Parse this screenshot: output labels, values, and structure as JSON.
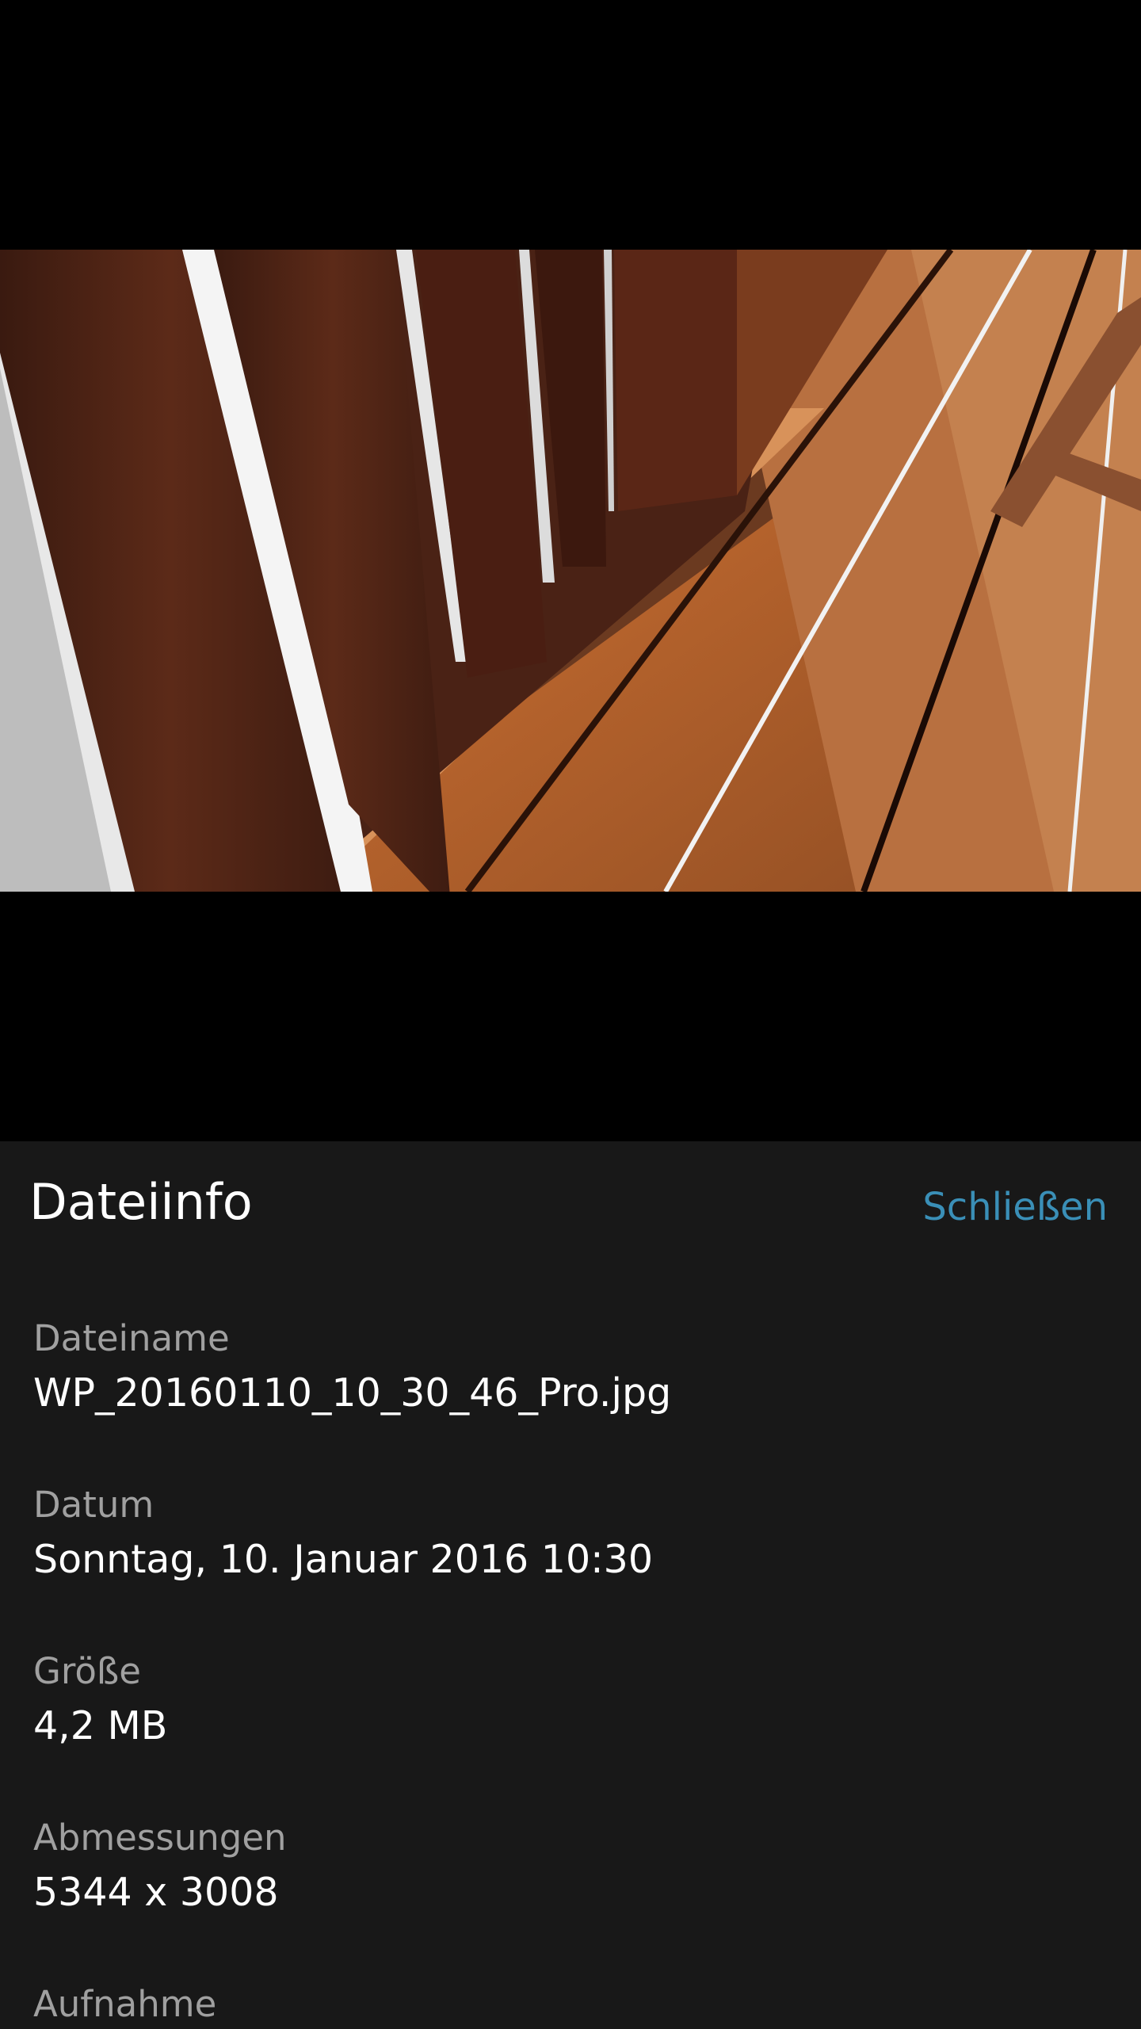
{
  "photo": {
    "description_icon": "image-photo"
  },
  "file_info": {
    "title": "Dateiinfo",
    "close_label": "Schließen",
    "accent_color": "#3a8fb7",
    "fields": [
      {
        "label": "Dateiname",
        "value": "WP_20160110_10_30_46_Pro.jpg"
      },
      {
        "label": "Datum",
        "value": "Sonntag, 10. Januar 2016 10:30"
      },
      {
        "label": "Größe",
        "value": "4,2 MB"
      },
      {
        "label": "Abmessungen",
        "value": "5344 x 3008"
      },
      {
        "label": "Aufnahme",
        "value": ""
      }
    ]
  }
}
